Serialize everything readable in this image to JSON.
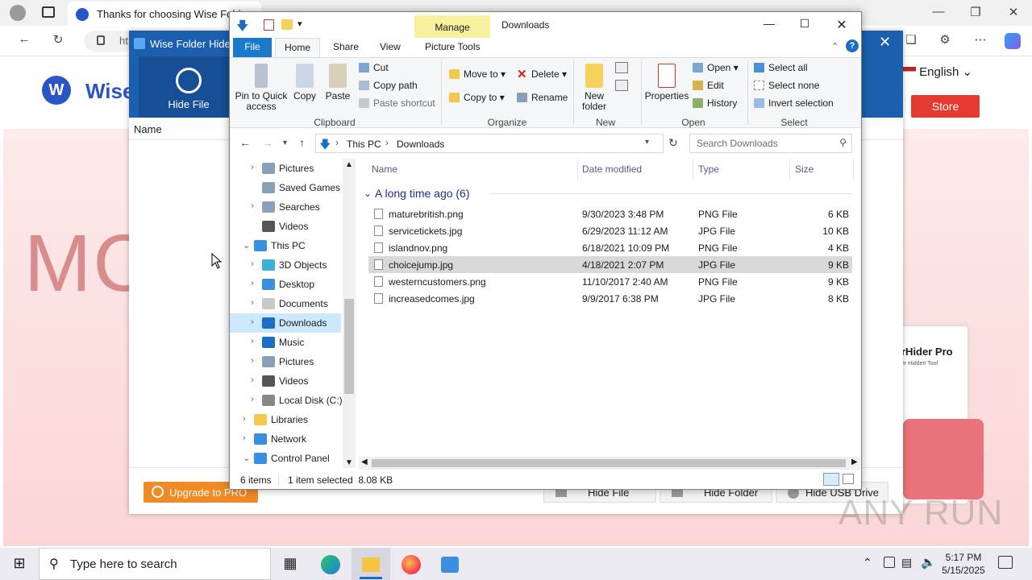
{
  "browser": {
    "tab_title": "Thanks for choosing Wise Folde",
    "address_partial": "ht"
  },
  "webpage": {
    "brand": "Wise",
    "hero_text": "MC",
    "language": "English",
    "store_button": "Store",
    "product_box_title": "rHider Pro",
    "product_box_subtitle": "er Hidden Tool"
  },
  "wise_folder_hider": {
    "title": "Wise Folder Hider",
    "hide_file_tab": "Hide File",
    "column_name": "Name",
    "upgrade_button": "Upgrade to PRO",
    "buttons": {
      "hide_file": "Hide File",
      "hide_folder": "Hide Folder",
      "hide_usb": "Hide USB Drive"
    }
  },
  "explorer": {
    "title": "Downloads",
    "manage_tab": "Manage",
    "picture_tools_tab": "Picture Tools",
    "ribbon_tabs": {
      "file": "File",
      "home": "Home",
      "share": "Share",
      "view": "View"
    },
    "clipboard": {
      "pin": "Pin to Quick access",
      "copy": "Copy",
      "paste": "Paste",
      "cut": "Cut",
      "copy_path": "Copy path",
      "paste_shortcut": "Paste shortcut",
      "group": "Clipboard"
    },
    "organize": {
      "move_to": "Move to",
      "copy_to": "Copy to",
      "delete": "Delete",
      "rename": "Rename",
      "group": "Organize"
    },
    "new": {
      "new_folder": "New folder",
      "group": "New"
    },
    "open": {
      "properties": "Properties",
      "open": "Open",
      "edit": "Edit",
      "history": "History",
      "group": "Open"
    },
    "select": {
      "select_all": "Select all",
      "select_none": "Select none",
      "invert": "Invert selection",
      "group": "Select"
    },
    "breadcrumb": [
      "This PC",
      "Downloads"
    ],
    "search_placeholder": "Search Downloads",
    "tree": [
      {
        "label": "Pictures"
      },
      {
        "label": "Saved Games"
      },
      {
        "label": "Searches"
      },
      {
        "label": "Videos"
      },
      {
        "label": "This PC"
      },
      {
        "label": "3D Objects"
      },
      {
        "label": "Desktop"
      },
      {
        "label": "Documents"
      },
      {
        "label": "Downloads"
      },
      {
        "label": "Music"
      },
      {
        "label": "Pictures"
      },
      {
        "label": "Videos"
      },
      {
        "label": "Local Disk (C:)"
      },
      {
        "label": "Libraries"
      },
      {
        "label": "Network"
      },
      {
        "label": "Control Panel"
      }
    ],
    "columns": {
      "name": "Name",
      "date": "Date modified",
      "type": "Type",
      "size": "Size"
    },
    "group_header": "A long time ago (6)",
    "files": [
      {
        "name": "maturebritish.png",
        "date": "9/30/2023 3:48 PM",
        "type": "PNG File",
        "size": "6 KB"
      },
      {
        "name": "servicetickets.jpg",
        "date": "6/29/2023 11:12 AM",
        "type": "JPG File",
        "size": "10 KB"
      },
      {
        "name": "islandnov.png",
        "date": "6/18/2021 10:09 PM",
        "type": "PNG File",
        "size": "4 KB"
      },
      {
        "name": "choicejump.jpg",
        "date": "4/18/2021 2:07 PM",
        "type": "JPG File",
        "size": "9 KB"
      },
      {
        "name": "westerncustomers.png",
        "date": "11/10/2017 2:40 AM",
        "type": "PNG File",
        "size": "9 KB"
      },
      {
        "name": "increasedcomes.jpg",
        "date": "9/9/2017 6:38 PM",
        "type": "JPG File",
        "size": "8 KB"
      }
    ],
    "status": {
      "items": "6 items",
      "selected": "1 item selected  8.08 KB"
    }
  },
  "taskbar": {
    "search_placeholder": "Type here to search",
    "time": "5:17 PM",
    "date": "5/15/2025"
  },
  "watermark": "ANY RUN"
}
